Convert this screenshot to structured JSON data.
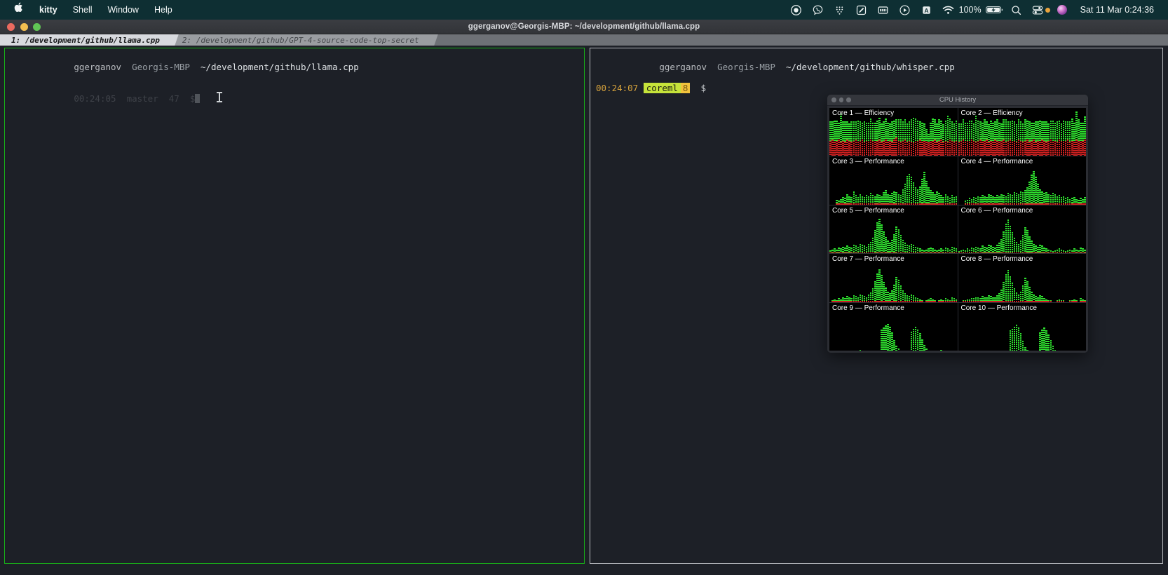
{
  "menubar": {
    "apple_glyph": "",
    "items": [
      {
        "label": "kitty",
        "bold": true
      },
      {
        "label": "Shell",
        "bold": false
      },
      {
        "label": "Window",
        "bold": false
      },
      {
        "label": "Help",
        "bold": false
      }
    ],
    "status_icons": [
      "record-icon",
      "viber-icon",
      "grid-dots-icon",
      "pencil-note-icon",
      "presentation-icon",
      "play-circle-icon",
      "input-source-A-icon",
      "wifi-icon"
    ],
    "battery_percent": "100%",
    "battery_icon": "battery-charging-icon",
    "search_icon": "spotlight-search-icon",
    "control_center_icon": "control-center-icon",
    "notification_dot": "orange-status-dot",
    "siri_icon": "siri-orb-icon",
    "clock": "Sat 11 Mar  0:24:36"
  },
  "window": {
    "title": "ggerganov@Georgis-MBP: ~/development/github/llama.cpp",
    "traffic_lights": [
      "close-button",
      "minimize-button",
      "zoom-button"
    ],
    "tabs": [
      {
        "label": "1: /development/github/llama.cpp",
        "active": true
      },
      {
        "label": "2: /development/github/GPT-4-source-code-top-secret",
        "active": false
      }
    ]
  },
  "panes": {
    "left": {
      "active": true,
      "border_color": "#18b218",
      "prompt_user": "ggerganov",
      "prompt_host": "Georgis-MBP",
      "prompt_path": "~/development/github/llama.cpp",
      "second_line": "00:24:05  master  47  $",
      "cursor_visible": true
    },
    "right": {
      "active": false,
      "border_color": "#b9bcc0",
      "prompt_user": "ggerganov",
      "prompt_host": "Georgis-MBP",
      "prompt_path": "~/development/github/whisper.cpp",
      "time": "00:24:07",
      "segment_env": "coreml",
      "segment_branch": "8",
      "prompt_symbol": "$"
    }
  },
  "cpu_window": {
    "title": "CPU History",
    "traffic_lights": [
      "close-button",
      "minimize-button",
      "zoom-button"
    ],
    "colors": {
      "user": "#2ee02e",
      "system": "#d02020",
      "background": "#000000"
    },
    "cores": [
      {
        "label": "Core 1 — Efficiency",
        "user": [
          40,
          38,
          44,
          42,
          36,
          58,
          40,
          42,
          38,
          36,
          42,
          40,
          38,
          44,
          40,
          36,
          42,
          38,
          40,
          44,
          38,
          40,
          42,
          46,
          38,
          40,
          44,
          40,
          36,
          42,
          40,
          38,
          44,
          46,
          40,
          42,
          38,
          40,
          46,
          52,
          48,
          42,
          38,
          40,
          36,
          26,
          18,
          40,
          46,
          42,
          38,
          44,
          40,
          36,
          42,
          54,
          44,
          40,
          38,
          42
        ],
        "system": [
          32,
          34,
          30,
          32,
          34,
          30,
          32,
          30,
          34,
          32,
          30,
          32,
          34,
          30,
          32,
          34,
          30,
          32,
          30,
          34,
          32,
          30,
          32,
          34,
          30,
          32,
          34,
          30,
          32,
          30,
          34,
          38,
          32,
          30,
          32,
          34,
          30,
          32,
          30,
          28,
          30,
          32,
          34,
          30,
          32,
          30,
          28,
          30,
          32,
          34,
          30,
          32,
          34,
          30,
          32,
          30,
          34,
          32,
          30,
          32
        ]
      },
      {
        "label": "Core 2 — Efficiency",
        "user": [
          38,
          36,
          42,
          40,
          38,
          44,
          40,
          36,
          54,
          42,
          38,
          40,
          44,
          38,
          36,
          42,
          40,
          38,
          44,
          40,
          36,
          42,
          46,
          40,
          38,
          44,
          40,
          36,
          42,
          40,
          38,
          44,
          40,
          42,
          38,
          36,
          42,
          40,
          44,
          38,
          40,
          42,
          36,
          40,
          44,
          38,
          42,
          40,
          36,
          44,
          40,
          38,
          42,
          46,
          40,
          58,
          44,
          40,
          38,
          48
        ],
        "system": [
          30,
          32,
          34,
          30,
          32,
          30,
          34,
          32,
          30,
          32,
          34,
          30,
          32,
          34,
          30,
          32,
          30,
          34,
          32,
          30,
          32,
          34,
          30,
          32,
          34,
          30,
          32,
          30,
          34,
          32,
          30,
          32,
          34,
          30,
          32,
          34,
          30,
          32,
          30,
          34,
          32,
          30,
          32,
          34,
          30,
          32,
          30,
          34,
          32,
          30,
          32,
          34,
          30,
          32,
          30,
          34,
          32,
          30,
          32,
          34
        ]
      },
      {
        "label": "Core 3 — Performance",
        "user": [
          0,
          0,
          0,
          8,
          6,
          10,
          14,
          12,
          20,
          16,
          14,
          26,
          18,
          14,
          20,
          16,
          14,
          18,
          16,
          22,
          18,
          16,
          20,
          18,
          16,
          24,
          28,
          20,
          18,
          22,
          26,
          24,
          20,
          18,
          30,
          42,
          58,
          62,
          56,
          44,
          34,
          30,
          36,
          52,
          66,
          48,
          34,
          28,
          24,
          20,
          26,
          22,
          18,
          14,
          20,
          16,
          12,
          18,
          14,
          16
        ],
        "system": [
          0,
          0,
          0,
          2,
          2,
          2,
          2,
          2,
          2,
          2,
          2,
          2,
          2,
          2,
          2,
          2,
          2,
          2,
          2,
          2,
          2,
          2,
          2,
          2,
          2,
          2,
          2,
          2,
          2,
          2,
          2,
          2,
          2,
          2,
          2,
          2,
          2,
          2,
          2,
          2,
          2,
          2,
          2,
          2,
          2,
          2,
          2,
          2,
          2,
          2,
          2,
          2,
          2,
          2,
          2,
          2,
          2,
          2,
          2,
          2
        ]
      },
      {
        "label": "Core 4 — Performance",
        "user": [
          0,
          0,
          0,
          6,
          8,
          12,
          10,
          14,
          12,
          16,
          14,
          18,
          16,
          14,
          20,
          18,
          16,
          14,
          18,
          16,
          20,
          18,
          16,
          22,
          20,
          18,
          24,
          22,
          20,
          26,
          24,
          28,
          34,
          46,
          60,
          68,
          56,
          42,
          30,
          26,
          22,
          24,
          20,
          18,
          22,
          20,
          16,
          18,
          14,
          16,
          12,
          14,
          10,
          12,
          14,
          10,
          8,
          12,
          10,
          14
        ],
        "system": [
          0,
          0,
          0,
          2,
          2,
          2,
          2,
          2,
          2,
          2,
          2,
          2,
          2,
          2,
          2,
          2,
          2,
          2,
          2,
          2,
          2,
          2,
          2,
          2,
          2,
          2,
          2,
          2,
          2,
          2,
          2,
          2,
          2,
          2,
          2,
          2,
          2,
          2,
          2,
          2,
          2,
          2,
          2,
          2,
          2,
          2,
          2,
          2,
          2,
          2,
          2,
          2,
          2,
          2,
          2,
          2,
          2,
          2,
          2,
          2
        ]
      },
      {
        "label": "Core 5 — Performance",
        "user": [
          4,
          6,
          8,
          6,
          10,
          8,
          12,
          10,
          14,
          12,
          10,
          16,
          14,
          12,
          18,
          16,
          14,
          12,
          18,
          22,
          30,
          46,
          62,
          70,
          58,
          44,
          32,
          24,
          20,
          26,
          38,
          54,
          48,
          36,
          26,
          20,
          16,
          14,
          18,
          16,
          12,
          10,
          8,
          6,
          4,
          6,
          8,
          10,
          8,
          6,
          4,
          6,
          8,
          6,
          10,
          8,
          6,
          12,
          10,
          8
        ],
        "system": [
          2,
          2,
          2,
          2,
          2,
          2,
          2,
          2,
          2,
          2,
          2,
          2,
          2,
          2,
          2,
          2,
          2,
          2,
          2,
          2,
          2,
          2,
          2,
          2,
          2,
          2,
          2,
          2,
          2,
          2,
          2,
          2,
          2,
          2,
          2,
          2,
          2,
          2,
          2,
          2,
          2,
          2,
          2,
          2,
          2,
          2,
          2,
          2,
          2,
          2,
          2,
          2,
          2,
          2,
          2,
          2,
          2,
          2,
          2,
          2
        ]
      },
      {
        "label": "Core 6 — Performance",
        "user": [
          2,
          4,
          6,
          4,
          8,
          6,
          10,
          8,
          12,
          10,
          8,
          14,
          12,
          10,
          16,
          14,
          12,
          10,
          16,
          20,
          28,
          44,
          60,
          68,
          56,
          42,
          30,
          22,
          18,
          24,
          36,
          52,
          46,
          34,
          24,
          18,
          14,
          12,
          16,
          14,
          10,
          8,
          6,
          4,
          2,
          4,
          6,
          8,
          6,
          4,
          2,
          4,
          6,
          4,
          8,
          6,
          4,
          10,
          8,
          6
        ],
        "system": [
          2,
          2,
          2,
          2,
          2,
          2,
          2,
          2,
          2,
          2,
          2,
          2,
          2,
          2,
          2,
          2,
          2,
          2,
          2,
          2,
          2,
          2,
          2,
          2,
          2,
          2,
          2,
          2,
          2,
          2,
          2,
          2,
          2,
          2,
          2,
          2,
          2,
          2,
          2,
          2,
          2,
          2,
          2,
          2,
          2,
          2,
          2,
          2,
          2,
          2,
          2,
          2,
          2,
          2,
          2,
          2,
          2,
          2,
          2,
          2
        ]
      },
      {
        "label": "Core 7 — Performance",
        "user": [
          0,
          2,
          4,
          2,
          6,
          4,
          8,
          6,
          10,
          8,
          6,
          12,
          10,
          8,
          14,
          12,
          10,
          8,
          14,
          18,
          26,
          42,
          58,
          66,
          54,
          40,
          28,
          20,
          16,
          22,
          34,
          50,
          44,
          32,
          22,
          16,
          12,
          10,
          14,
          12,
          8,
          6,
          4,
          2,
          0,
          2,
          4,
          6,
          4,
          2,
          0,
          2,
          4,
          2,
          6,
          4,
          2,
          8,
          6,
          4
        ],
        "system": [
          0,
          2,
          2,
          2,
          2,
          2,
          2,
          2,
          2,
          2,
          2,
          2,
          2,
          2,
          2,
          2,
          2,
          2,
          2,
          2,
          2,
          2,
          2,
          2,
          2,
          2,
          2,
          2,
          2,
          2,
          2,
          2,
          2,
          2,
          2,
          2,
          2,
          2,
          2,
          2,
          2,
          2,
          2,
          2,
          0,
          2,
          2,
          2,
          2,
          2,
          0,
          2,
          2,
          2,
          2,
          2,
          2,
          2,
          2,
          2
        ]
      },
      {
        "label": "Core 8 — Performance",
        "user": [
          0,
          0,
          2,
          2,
          4,
          4,
          6,
          6,
          8,
          8,
          6,
          10,
          8,
          8,
          12,
          10,
          8,
          8,
          12,
          16,
          24,
          40,
          56,
          64,
          52,
          38,
          26,
          18,
          14,
          20,
          32,
          48,
          42,
          30,
          20,
          14,
          10,
          8,
          12,
          10,
          6,
          4,
          2,
          2,
          0,
          0,
          2,
          4,
          2,
          2,
          0,
          0,
          2,
          2,
          4,
          2,
          0,
          6,
          4,
          2
        ],
        "system": [
          0,
          0,
          2,
          2,
          2,
          2,
          2,
          2,
          2,
          2,
          2,
          2,
          2,
          2,
          2,
          2,
          2,
          2,
          2,
          2,
          2,
          2,
          2,
          2,
          2,
          2,
          2,
          2,
          2,
          2,
          2,
          2,
          2,
          2,
          2,
          2,
          2,
          2,
          2,
          2,
          2,
          2,
          2,
          2,
          0,
          0,
          2,
          2,
          2,
          2,
          0,
          0,
          2,
          2,
          2,
          2,
          0,
          2,
          2,
          2
        ]
      },
      {
        "label": "Core 9 — Performance",
        "user": [
          0,
          0,
          0,
          0,
          0,
          0,
          0,
          0,
          0,
          0,
          0,
          0,
          0,
          0,
          2,
          0,
          0,
          0,
          0,
          0,
          0,
          0,
          0,
          0,
          44,
          48,
          52,
          56,
          50,
          38,
          22,
          10,
          4,
          0,
          0,
          0,
          0,
          0,
          40,
          46,
          50,
          44,
          36,
          24,
          12,
          4,
          0,
          0,
          0,
          0,
          0,
          0,
          2,
          0,
          0,
          0,
          0,
          0,
          0,
          0
        ],
        "system": [
          0,
          0,
          0,
          0,
          0,
          0,
          0,
          0,
          0,
          0,
          0,
          0,
          0,
          0,
          0,
          0,
          0,
          0,
          0,
          0,
          0,
          0,
          0,
          0,
          0,
          0,
          0,
          0,
          0,
          0,
          0,
          0,
          0,
          0,
          0,
          0,
          0,
          0,
          0,
          0,
          0,
          0,
          0,
          0,
          0,
          0,
          0,
          0,
          0,
          0,
          0,
          0,
          0,
          0,
          0,
          0,
          0,
          0,
          0,
          0
        ]
      },
      {
        "label": "Core 10 — Performance",
        "user": [
          0,
          0,
          0,
          0,
          0,
          0,
          0,
          0,
          0,
          0,
          0,
          0,
          0,
          0,
          0,
          0,
          0,
          0,
          0,
          0,
          0,
          0,
          0,
          0,
          42,
          46,
          50,
          54,
          48,
          36,
          20,
          8,
          2,
          0,
          0,
          0,
          0,
          0,
          38,
          44,
          48,
          42,
          34,
          22,
          10,
          2,
          0,
          0,
          0,
          0,
          0,
          0,
          0,
          0,
          0,
          0,
          0,
          0,
          0,
          0
        ],
        "system": [
          0,
          0,
          0,
          0,
          0,
          0,
          0,
          0,
          0,
          0,
          0,
          0,
          0,
          0,
          0,
          0,
          0,
          0,
          0,
          0,
          0,
          0,
          0,
          0,
          0,
          0,
          0,
          0,
          0,
          0,
          0,
          0,
          0,
          0,
          0,
          0,
          0,
          0,
          0,
          0,
          0,
          0,
          0,
          0,
          0,
          0,
          0,
          0,
          0,
          0,
          0,
          0,
          0,
          0,
          0,
          0,
          0,
          0,
          0,
          0
        ]
      }
    ]
  }
}
